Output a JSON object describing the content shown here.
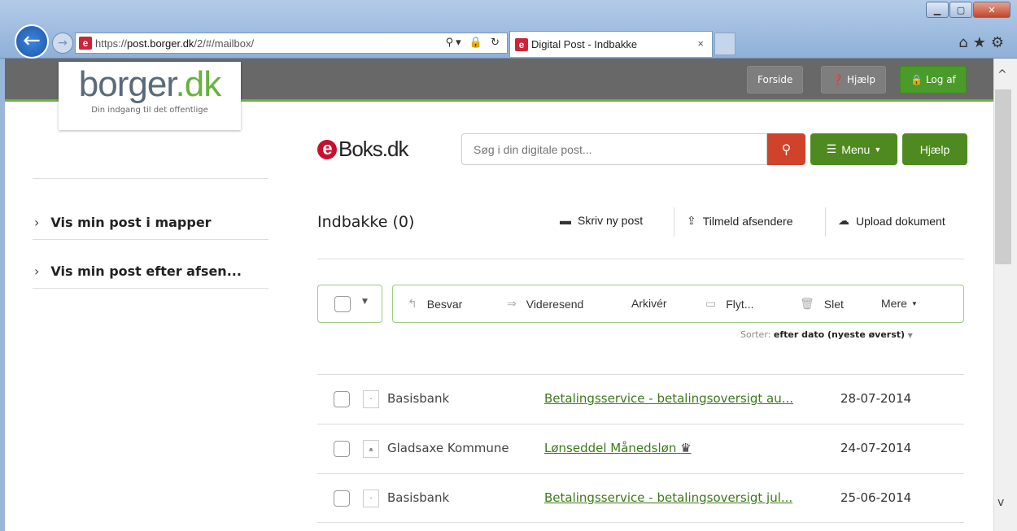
{
  "browser": {
    "url_prefix": "https://",
    "url_domain": "post.borger.dk",
    "url_path": "/2/#/mailbox/",
    "tab_title": "Digital Post - Indbakke",
    "tab_close": "×"
  },
  "portal": {
    "logo_main": "borger",
    "logo_tld": ".dk",
    "logo_tagline": "Din indgang til det offentlige",
    "forside": "Forside",
    "hjaelp": "Hjælp",
    "logaf": "Log af"
  },
  "eboks": {
    "brand": "Boks.dk",
    "search_placeholder": "Søg i din digitale post...",
    "menu": "Menu",
    "hjaelp": "Hjælp"
  },
  "sidebar": {
    "items": [
      {
        "label": "Vis min post i mapper"
      },
      {
        "label": "Vis min post efter afsen..."
      }
    ]
  },
  "mailbox": {
    "title": "Indbakke (0)",
    "actions": {
      "new": "Skriv ny post",
      "subscribe": "Tilmeld afsendere",
      "upload": "Upload dokument"
    },
    "toolbar": {
      "reply": "Besvar",
      "forward": "Videresend",
      "archive": "Arkivér",
      "move": "Flyt...",
      "delete": "Slet",
      "more": "Mere"
    },
    "sort_label": "Sorter:",
    "sort_value": "efter dato (nyeste øverst)",
    "messages": [
      {
        "sender": "Basisbank",
        "subject": "Betalingsservice - betalingsoversigt au...",
        "date": "28-07-2014",
        "icon": "·"
      },
      {
        "sender": "Gladsaxe Kommune",
        "subject": "Lønseddel Månedsløn",
        "date": "24-07-2014",
        "icon": "ﻌ"
      },
      {
        "sender": "Basisbank",
        "subject": "Betalingsservice - betalingsoversigt jul...",
        "date": "25-06-2014",
        "icon": "·"
      }
    ]
  }
}
